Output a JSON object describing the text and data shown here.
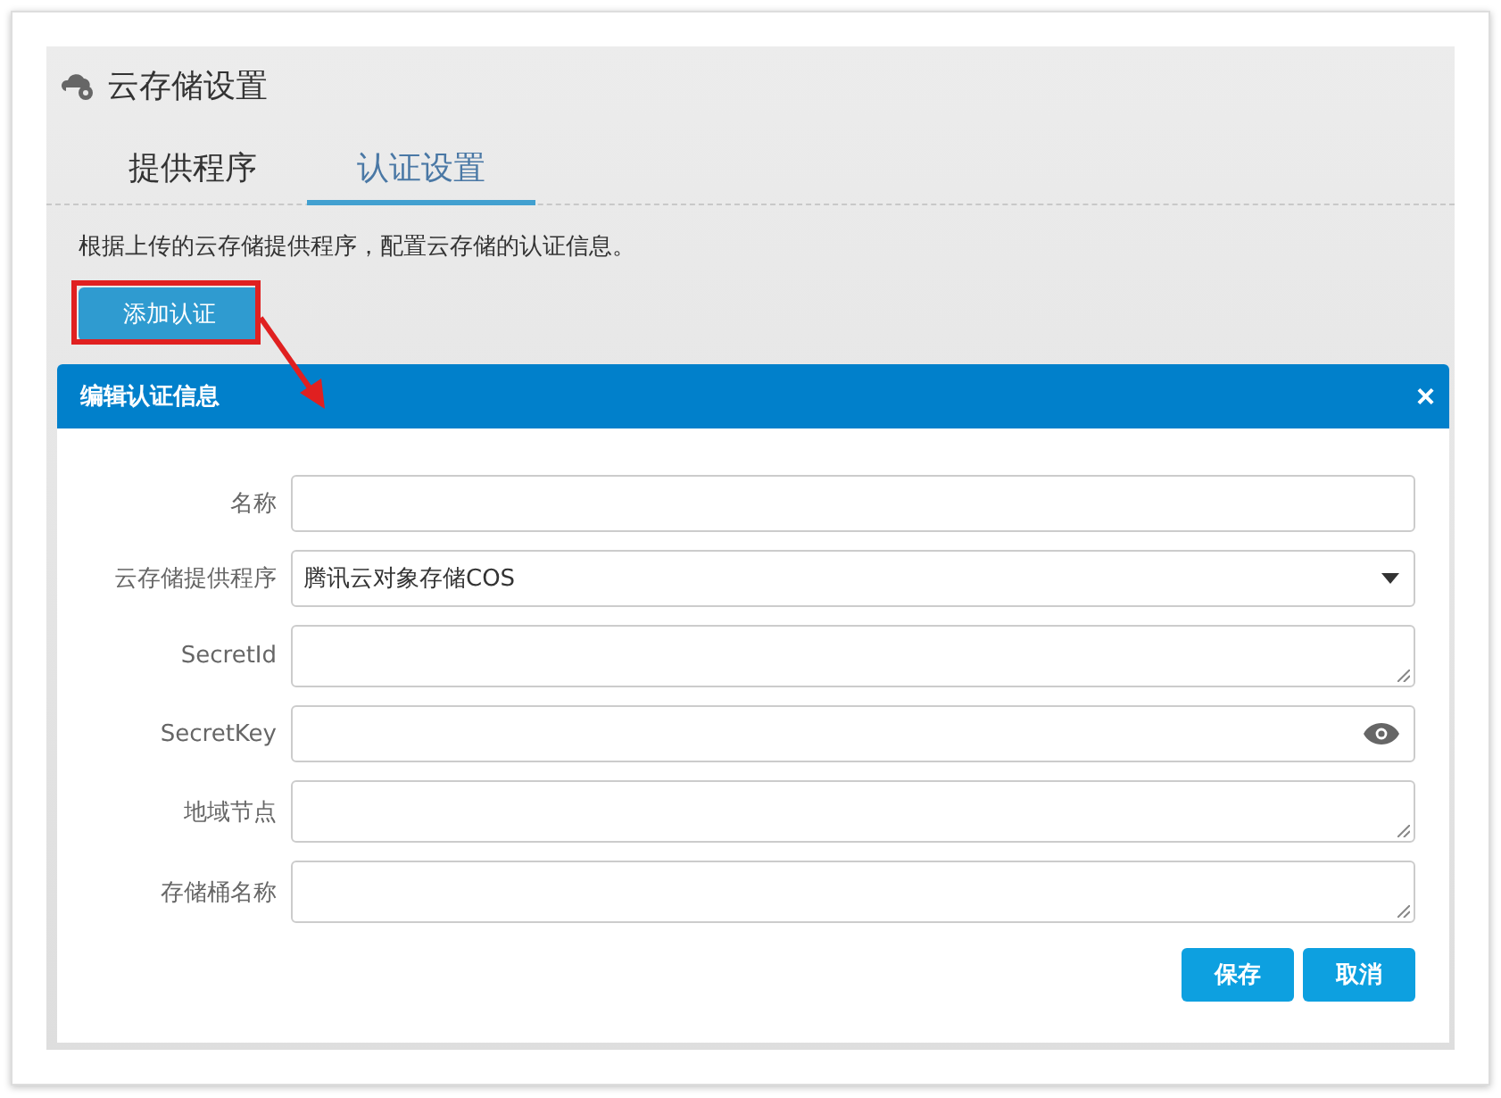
{
  "page": {
    "title": "云存储设置"
  },
  "tabs": [
    {
      "label": "提供程序",
      "selected": false
    },
    {
      "label": "认证设置",
      "selected": true
    }
  ],
  "description": "根据上传的云存储提供程序，配置云存储的认证信息。",
  "add_button": "添加认证",
  "dialog": {
    "title": "编辑认证信息",
    "close": "×",
    "fields": [
      {
        "label": "名称",
        "kind": "text"
      },
      {
        "label": "云存储提供程序",
        "kind": "select",
        "value": "腾讯云对象存储COS"
      },
      {
        "label": "SecretId",
        "kind": "textarea"
      },
      {
        "label": "SecretKey",
        "kind": "password"
      },
      {
        "label": "地域节点",
        "kind": "textarea"
      },
      {
        "label": "存储桶名称",
        "kind": "textarea"
      }
    ],
    "buttons": [
      "保存",
      "取消"
    ]
  }
}
